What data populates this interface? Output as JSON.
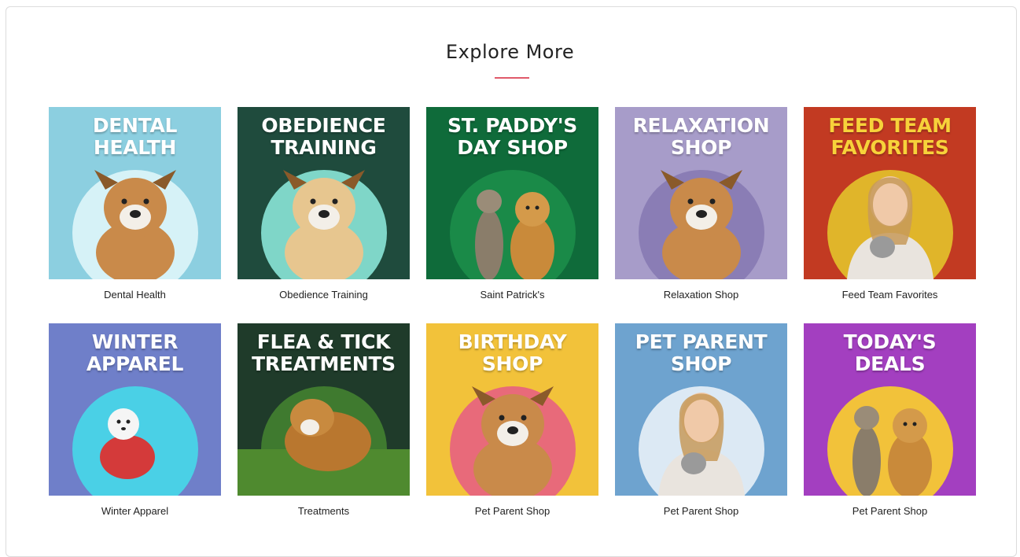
{
  "section": {
    "title": "Explore More"
  },
  "tiles": [
    {
      "heading": "DENTAL\nHEALTH",
      "caption": "Dental Health",
      "bg": "#8ccfe0",
      "heading_color": "#ffffff",
      "circle": "#d6f2f7",
      "animal": "dog"
    },
    {
      "heading": "OBEDIENCE\nTRAINING",
      "caption": "Obedience Training",
      "bg": "#1f4b3d",
      "heading_color": "#ffffff",
      "circle": "#7fd6c8",
      "animal": "puppy"
    },
    {
      "heading": "ST. PADDY'S\nDAY SHOP",
      "caption": "Saint Patrick's",
      "bg": "#0f6b3a",
      "heading_color": "#ffffff",
      "circle": "#1a8a48",
      "animal": "cat-and-dog"
    },
    {
      "heading": "RELAXATION\nSHOP",
      "caption": "Relaxation Shop",
      "bg": "#a79cc9",
      "heading_color": "#ffffff",
      "circle": "#8a7db5",
      "animal": "dog"
    },
    {
      "heading": "FEED TEAM\nFAVORITES",
      "caption": "Feed Team Favorites",
      "bg": "#c23a22",
      "heading_color": "#f7d23a",
      "circle": "#e0b52a",
      "animal": "person"
    },
    {
      "heading": "WINTER\nAPPAREL",
      "caption": "Winter Apparel",
      "bg": "#6f7fc9",
      "heading_color": "#ffffff",
      "circle": "#4ad0e6",
      "animal": "small-dog"
    },
    {
      "heading": "FLEA & TICK\nTREATMENTS",
      "caption": "Treatments",
      "bg": "#1f3b2a",
      "heading_color": "#ffffff",
      "circle": "#3f7a2f",
      "animal": "beagle"
    },
    {
      "heading": "BIRTHDAY\nSHOP",
      "caption": "Pet Parent Shop",
      "bg": "#f2c23a",
      "heading_color": "#ffffff",
      "circle": "#e86a7a",
      "animal": "dog"
    },
    {
      "heading": "PET PARENT\nSHOP",
      "caption": "Pet Parent Shop",
      "bg": "#6ea3cf",
      "heading_color": "#ffffff",
      "circle": "#dce9f4",
      "animal": "person"
    },
    {
      "heading": "TODAY'S\nDEALS",
      "caption": "Pet Parent Shop",
      "bg": "#a33fc0",
      "heading_color": "#ffffff",
      "circle": "#f2c23a",
      "animal": "cat-and-dog"
    }
  ]
}
